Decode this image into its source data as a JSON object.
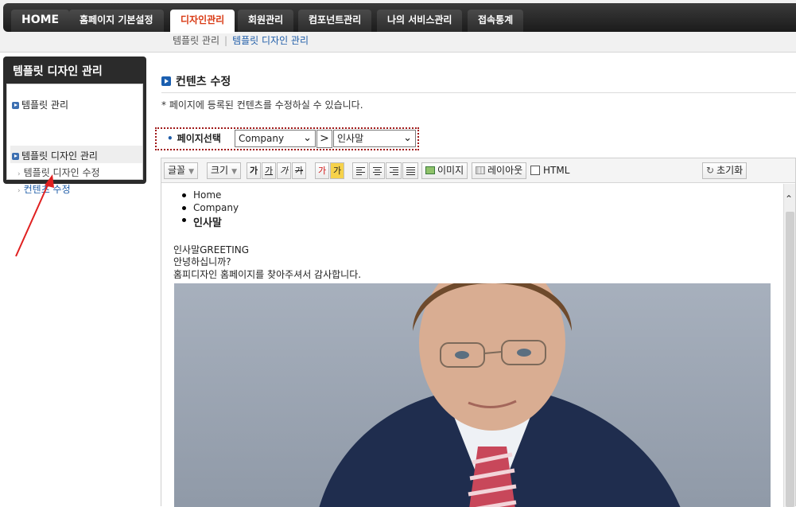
{
  "nav": {
    "tabs": [
      "HOME",
      "홈페이지 기본설정",
      "디자인관리",
      "회원관리",
      "컴포넌트관리",
      "나의 서비스관리",
      "접속통계"
    ],
    "active_tab": "디자인관리",
    "subnav": [
      "템플릿 관리",
      "템플릿 디자인 관리"
    ]
  },
  "left_panel": {
    "title": "템플릿 디자인 관리",
    "items": [
      "템플릿 관리",
      "템플릿 디자인 관리"
    ],
    "subitems": [
      "템플릿 디자인 수정",
      "컨텐츠 수정"
    ]
  },
  "content": {
    "heading": "컨텐츠 수정",
    "description": "* 페이지에 등록된 컨텐츠를 수정하실 수 있습니다.",
    "page_select_label": "페이지선택",
    "select1_value": "Company",
    "select2_value": "인사말",
    "gt": ">"
  },
  "toolbar": {
    "font": "글꼴",
    "size": "크기",
    "fmt": [
      "가",
      "가",
      "가",
      "가",
      "가",
      "가"
    ],
    "image": "이미지",
    "layout": "레이아웃",
    "html": "HTML",
    "reset": "초기화"
  },
  "editor_body": {
    "breadcrumbs": [
      "Home",
      "Company",
      "인사말"
    ],
    "lines": [
      "인사말GREETING",
      "안녕하십니까?",
      "홈피디자인 홈페이지를 찾아주셔서 감사합니다."
    ]
  },
  "colors": {
    "active_tab_text": "#d93a14",
    "link_blue": "#1f5da8",
    "dotted_border": "#a01818",
    "annotation_arrow": "#e02020"
  }
}
